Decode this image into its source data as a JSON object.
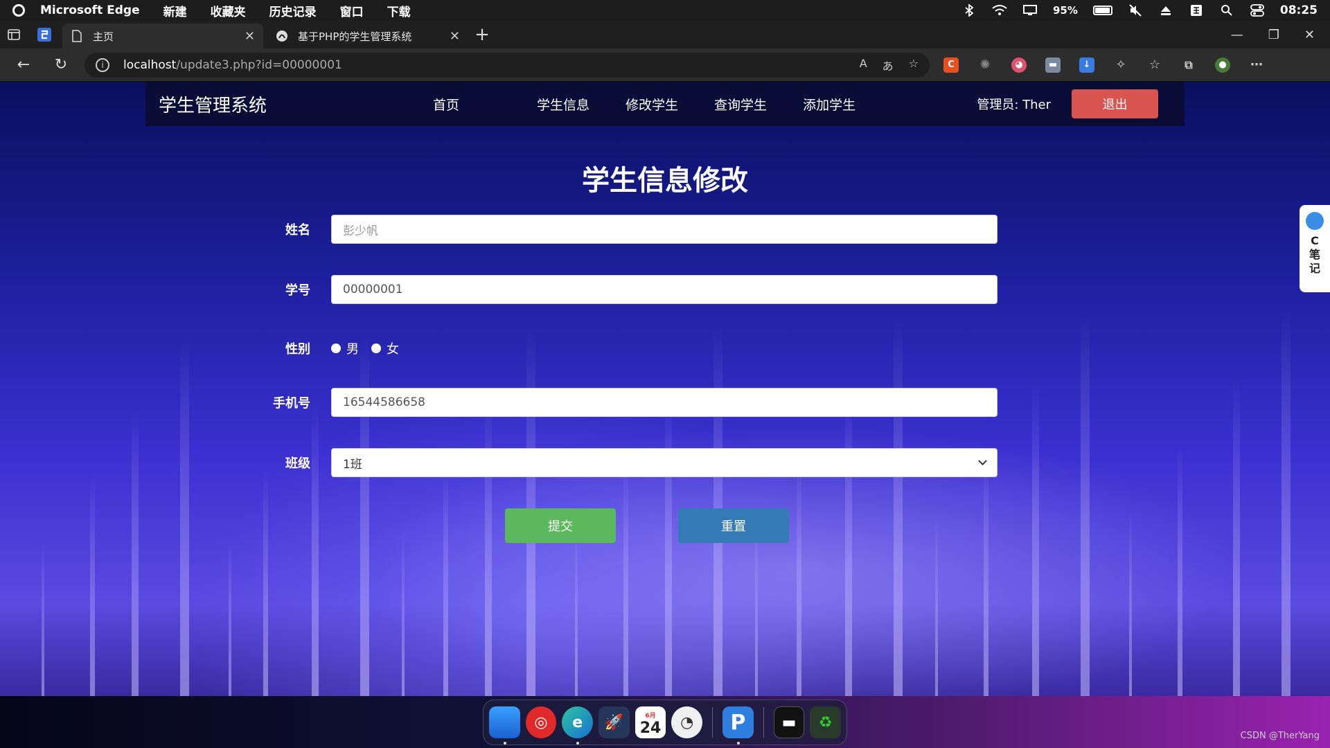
{
  "menubar": {
    "app_name": "Microsoft Edge",
    "items": [
      "新建",
      "收藏夹",
      "历史记录",
      "窗口",
      "下载"
    ],
    "battery_percent": "95%",
    "battery_level": 0.95,
    "time": "08:25"
  },
  "tabs": [
    {
      "title": "主页",
      "active": true
    },
    {
      "title": "基于PHP的学生管理系统",
      "active": false
    }
  ],
  "address_bar": {
    "host": "localhost",
    "path": "/update3.php?id=00000001"
  },
  "site": {
    "brand": "学生管理系统",
    "nav": [
      "首页",
      "学生信息",
      "修改学生",
      "查询学生",
      "添加学生"
    ],
    "admin_label": "管理员: Ther",
    "logout_label": "退出"
  },
  "form": {
    "title": "学生信息修改",
    "name_label": "姓名",
    "name_placeholder": "彭少帆",
    "id_label": "学号",
    "id_value": "00000001",
    "gender_label": "性别",
    "gender_male": "男",
    "gender_female": "女",
    "phone_label": "手机号",
    "phone_value": "16544586658",
    "class_label": "班级",
    "class_value": "1班",
    "submit_label": "提交",
    "reset_label": "重置"
  },
  "side_widget": {
    "chars": [
      "C",
      "笔",
      "记"
    ]
  },
  "dock": {
    "calendar_month": "6月",
    "calendar_day": "24"
  },
  "watermark": "CSDN @TherYang",
  "colors": {
    "logout": "#d9534f",
    "submit": "#5cb85c",
    "reset": "#337ab7"
  }
}
